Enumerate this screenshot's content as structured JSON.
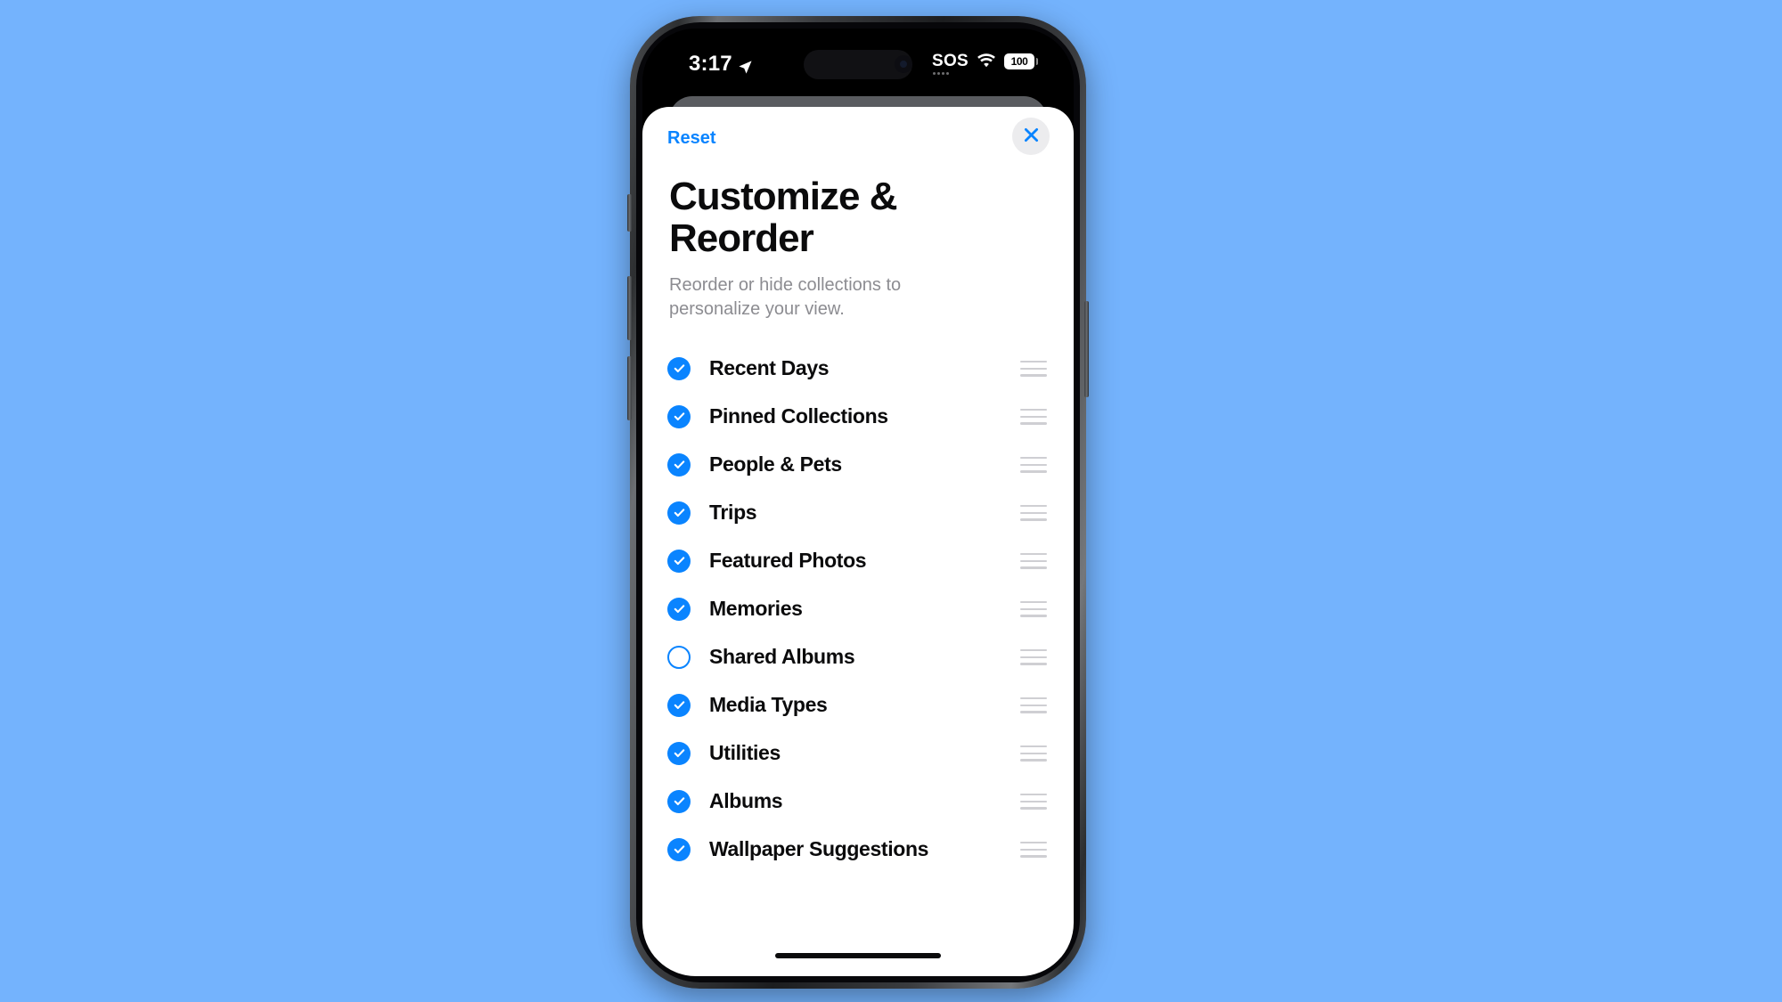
{
  "background_color": "#74b3fd",
  "status_bar": {
    "time": "3:17",
    "location_icon": "location-arrow-icon",
    "sos_label": "SOS",
    "wifi_icon": "wifi-icon",
    "battery_level": "100"
  },
  "sheet": {
    "reset_label": "Reset",
    "close_icon": "close-x-icon",
    "title": "Customize & Reorder",
    "subtitle": "Reorder or hide collections to personalize your view.",
    "accent_color": "#0a84ff",
    "items": [
      {
        "label": "Recent Days",
        "checked": true,
        "handle_icon": "drag-handle-icon"
      },
      {
        "label": "Pinned Collections",
        "checked": true,
        "handle_icon": "drag-handle-icon"
      },
      {
        "label": "People & Pets",
        "checked": true,
        "handle_icon": "drag-handle-icon"
      },
      {
        "label": "Trips",
        "checked": true,
        "handle_icon": "drag-handle-icon"
      },
      {
        "label": "Featured Photos",
        "checked": true,
        "handle_icon": "drag-handle-icon"
      },
      {
        "label": "Memories",
        "checked": true,
        "handle_icon": "drag-handle-icon"
      },
      {
        "label": "Shared Albums",
        "checked": false,
        "handle_icon": "drag-handle-icon"
      },
      {
        "label": "Media Types",
        "checked": true,
        "handle_icon": "drag-handle-icon"
      },
      {
        "label": "Utilities",
        "checked": true,
        "handle_icon": "drag-handle-icon"
      },
      {
        "label": "Albums",
        "checked": true,
        "handle_icon": "drag-handle-icon"
      },
      {
        "label": "Wallpaper Suggestions",
        "checked": true,
        "handle_icon": "drag-handle-icon"
      }
    ]
  }
}
